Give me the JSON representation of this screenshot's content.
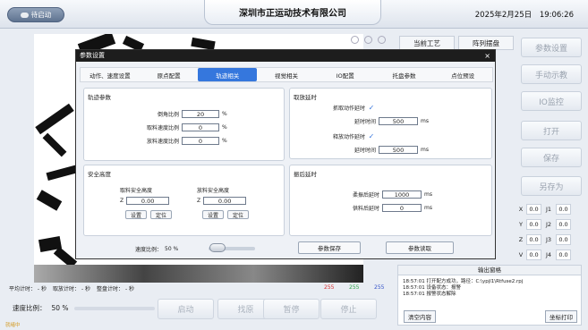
{
  "header": {
    "status_button": "待启动",
    "company": "深圳市正运动技术有限公司",
    "date": "2025年2月25日",
    "time": "19:06:26"
  },
  "process": {
    "label": "当前工艺",
    "value": "阵列摆盘"
  },
  "right_buttons": [
    "参数设置",
    "手动示教",
    "IO监控",
    "打开",
    "保存",
    "另存为"
  ],
  "coords": [
    {
      "l1": "X",
      "v1": "0.0",
      "l2": "J1",
      "v2": "0.0"
    },
    {
      "l1": "Y",
      "v1": "0.0",
      "l2": "J2",
      "v2": "0.0"
    },
    {
      "l1": "Z",
      "v1": "0.0",
      "l2": "J3",
      "v2": "0.0"
    },
    {
      "l1": "V",
      "v1": "0.0",
      "l2": "J4",
      "v2": "0.0"
    }
  ],
  "timers": {
    "avg_label": "平均计时：",
    "avg_unit": "秒",
    "take_label": "取放计时：",
    "take_unit": "秒",
    "tray_label": "整盘计时：",
    "tray_unit": "秒"
  },
  "rgb": {
    "r": "255",
    "g": "255",
    "b": "255",
    "r_color": "#d93030",
    "g_color": "#2fa64a",
    "b_color": "#3553c8"
  },
  "speed": {
    "label": "速度比例：",
    "value": "50 %"
  },
  "bottom_buttons": [
    "启动",
    "找原",
    "暂停",
    "停止"
  ],
  "status_text": "就绪中",
  "output": {
    "title": "输出窗格",
    "logs": [
      "18:57:01  打开配方成功，路径：C:\\ypjl1\\Rtfuse2.rpj",
      "18:57:01  设备状态：报警",
      "18:57:01  报警状态解除"
    ],
    "clear_button": "清空内容",
    "print_button": "坐标打印"
  },
  "dialog": {
    "title": "参数设置",
    "close": "×",
    "tabs": [
      "动作、速度设置",
      "原点配置",
      "轨迹相关",
      "视觉相关",
      "IO配置",
      "托盘参数",
      "点位预设"
    ],
    "active_tab": "轨迹相关",
    "traj": {
      "title": "轨迹参数",
      "chamfer_label": "倒角比例",
      "chamfer_value": "20",
      "take_speed_label": "取料速度比例",
      "take_speed_value": "0",
      "put_speed_label": "放料速度比例",
      "put_speed_value": "0",
      "unit": "%"
    },
    "action_delay": {
      "title": "取放延时",
      "grab_label": "抓取动作延时",
      "grab_delay_label": "延时时间",
      "grab_delay_value": "500",
      "release_label": "释放动作延时",
      "release_delay_label": "延时时间",
      "release_delay_value": "500",
      "unit": "ms"
    },
    "safe_height": {
      "title": "安全高度",
      "take_title": "取料安全高度",
      "take_z_label": "Z",
      "take_z_value": "0.00",
      "put_title": "放料安全高度",
      "put_z_label": "Z",
      "put_z_value": "0.00",
      "set_label": "设置",
      "locate_label": "定位"
    },
    "vibration": {
      "title": "振后延时",
      "take_label": "柔振后延时",
      "take_value": "1000",
      "put_label": "供料后延时",
      "put_value": "0",
      "unit": "ms"
    },
    "speed_ratio_label": "速度比例：",
    "speed_ratio_value": "50 %",
    "save_button": "参数保存",
    "read_button": "参数读取"
  },
  "colors": {
    "accent": "#3577dd",
    "title_bar": "#1d1d1d"
  }
}
